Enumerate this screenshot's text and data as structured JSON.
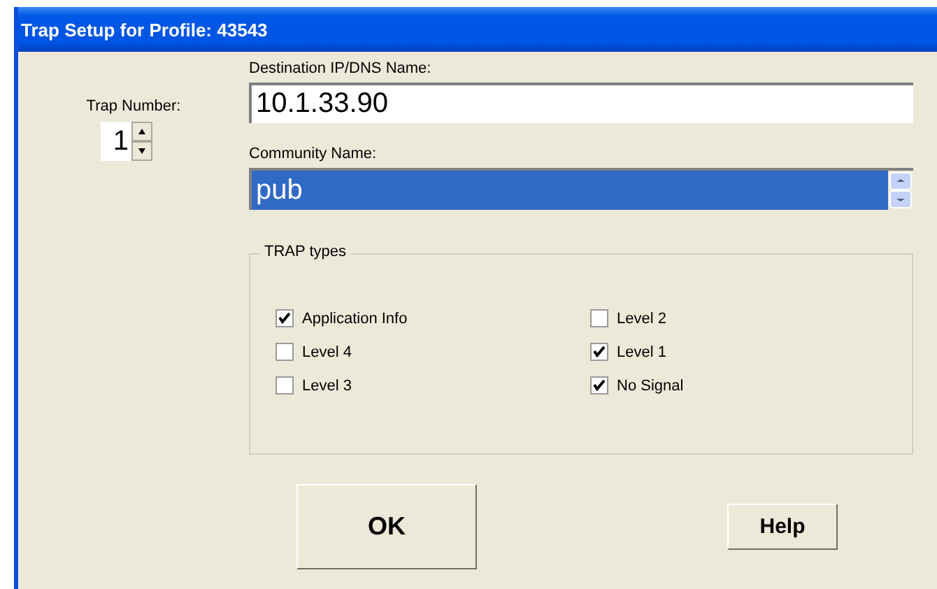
{
  "window": {
    "title": "Trap Setup for Profile:  43543"
  },
  "trap_number": {
    "label": "Trap Number:",
    "value": "1"
  },
  "destination": {
    "label": "Destination IP/DNS Name:",
    "value": "10.1.33.90"
  },
  "community": {
    "label": "Community Name:",
    "value": "pub",
    "selected": true
  },
  "trap_types": {
    "title": "TRAP types",
    "items": [
      {
        "label": "Application Info",
        "checked": true
      },
      {
        "label": "Level 2",
        "checked": false
      },
      {
        "label": "Level 4",
        "checked": false
      },
      {
        "label": "Level 1",
        "checked": true
      },
      {
        "label": "Level 3",
        "checked": false
      },
      {
        "label": "No Signal",
        "checked": true
      }
    ]
  },
  "buttons": [
    {
      "label": "OK",
      "kind": "primary"
    },
    {
      "label": "Help",
      "kind": "secondary"
    }
  ]
}
